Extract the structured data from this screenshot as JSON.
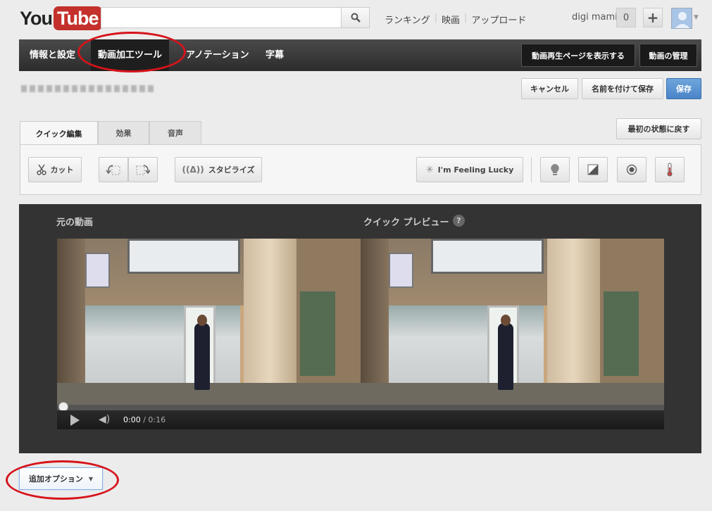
{
  "header": {
    "logo_you": "You",
    "logo_tube": "Tube",
    "search_placeholder": "",
    "nav": [
      "ランキング",
      "映画",
      "アップロード"
    ],
    "user_name": "digi mami",
    "notification_count": "0"
  },
  "tabbar": {
    "tabs": [
      "情報と設定",
      "動画加工ツール",
      "アノテーション",
      "字幕"
    ],
    "active_tab": "動画加工ツール",
    "view_page_button": "動画再生ページを表示する",
    "manage_button": "動画の管理"
  },
  "actions": {
    "cancel": "キャンセル",
    "save_as": "名前を付けて保存",
    "save": "保存"
  },
  "editor": {
    "tabs": [
      "クイック編集",
      "効果",
      "音声"
    ],
    "reset": "最初の状態に戻す",
    "cut": "カット",
    "stabilize": "スタビライズ",
    "feeling_lucky": "I'm Feeling Lucky"
  },
  "video": {
    "original_label": "元の動画",
    "preview_label": "クイック プレビュー",
    "help": "?",
    "time_current": "0:00",
    "time_separator": " / ",
    "time_total": "0:16",
    "progress": 0
  },
  "footer": {
    "more_options": "追加オプション"
  },
  "colors": {
    "accent_blue": "#4a84c8",
    "logo_red": "#c4302b",
    "annotation_red": "#d6141c"
  }
}
